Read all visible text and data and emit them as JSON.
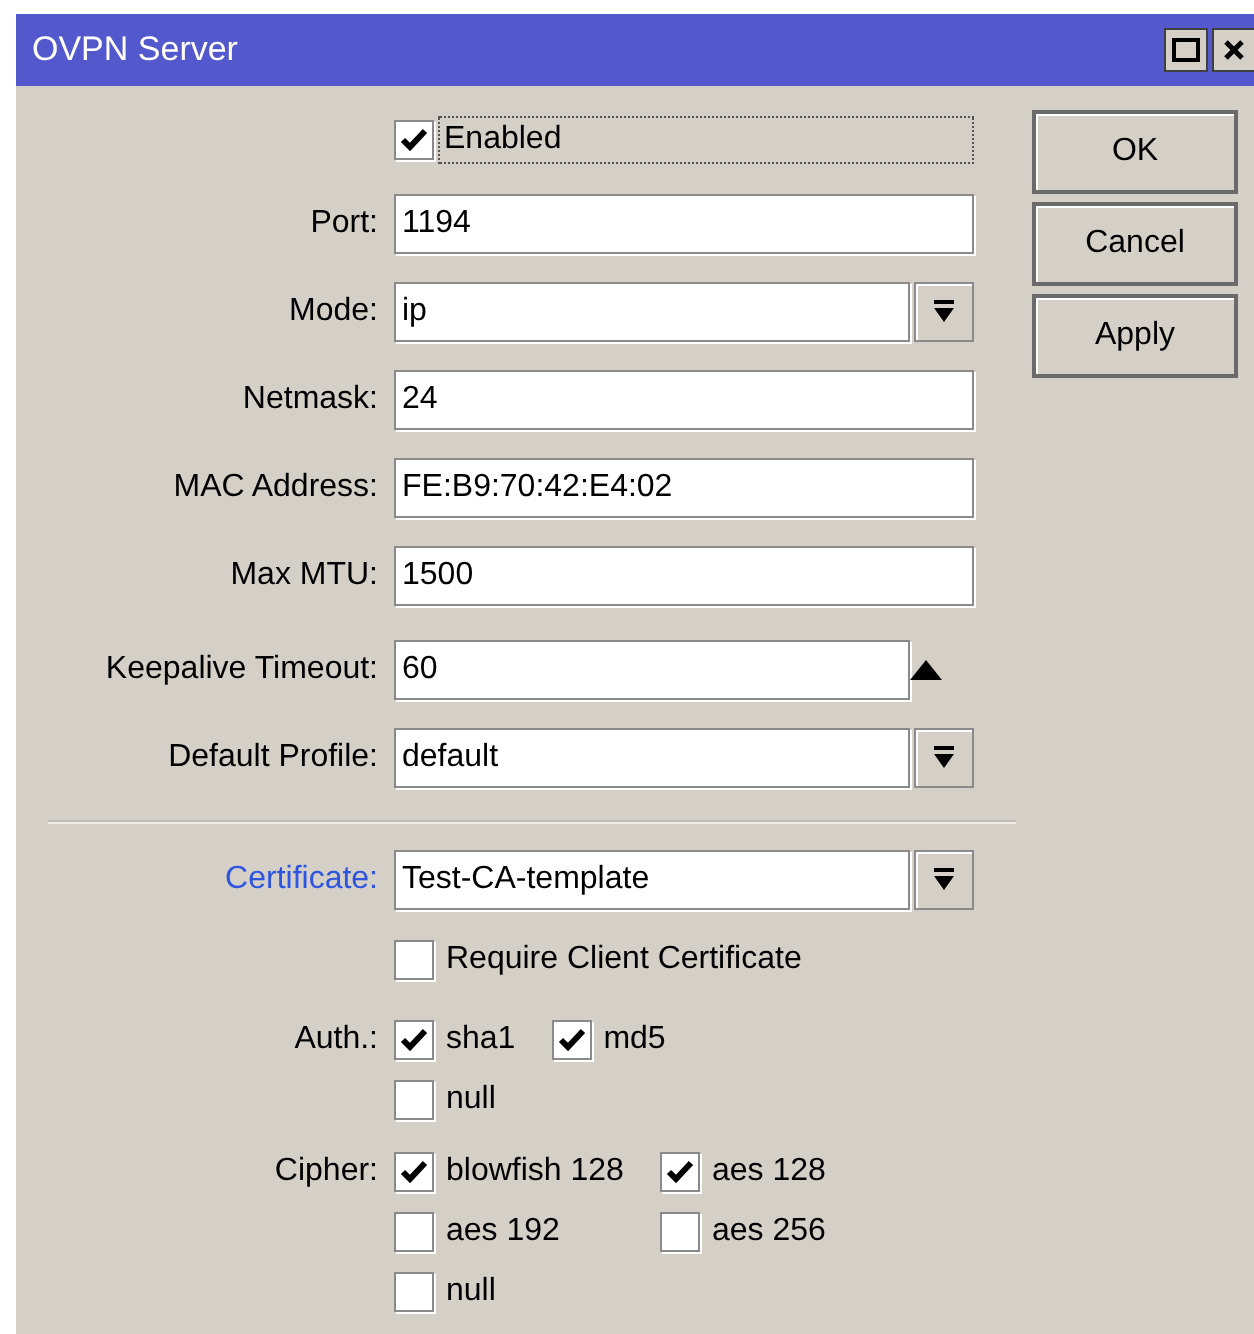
{
  "window": {
    "title": "OVPN Server"
  },
  "enabled": {
    "label": "Enabled",
    "checked": true
  },
  "fields": [
    {
      "label": "Port:",
      "value": "1194",
      "kind": "text"
    },
    {
      "label": "Mode:",
      "value": "ip",
      "kind": "dropdown"
    },
    {
      "label": "Netmask:",
      "value": "24",
      "kind": "text"
    },
    {
      "label": "MAC Address:",
      "value": "FE:B9:70:42:E4:02",
      "kind": "text"
    },
    {
      "label": "Max MTU:",
      "value": "1500",
      "kind": "text"
    },
    {
      "label": "Keepalive Timeout:",
      "value": "60",
      "kind": "spin"
    },
    {
      "label": "Default Profile:",
      "value": "default",
      "kind": "dropdown"
    }
  ],
  "certificate": {
    "label": "Certificate:",
    "value": "Test-CA-template"
  },
  "require_client_certificate": {
    "label": "Require Client Certificate",
    "checked": false
  },
  "option_groups": [
    {
      "label": "Auth.:",
      "options": [
        {
          "label": "sha1",
          "checked": true
        },
        {
          "label": "md5",
          "checked": true
        },
        {
          "label": "null",
          "checked": false
        }
      ]
    },
    {
      "label": "Cipher:",
      "options": [
        {
          "label": "blowfish 128",
          "checked": true
        },
        {
          "label": "aes 128",
          "checked": true
        },
        {
          "label": "aes 192",
          "checked": false
        },
        {
          "label": "aes 256",
          "checked": false
        },
        {
          "label": "null",
          "checked": false
        }
      ]
    }
  ],
  "buttons": [
    "OK",
    "Cancel",
    "Apply"
  ]
}
